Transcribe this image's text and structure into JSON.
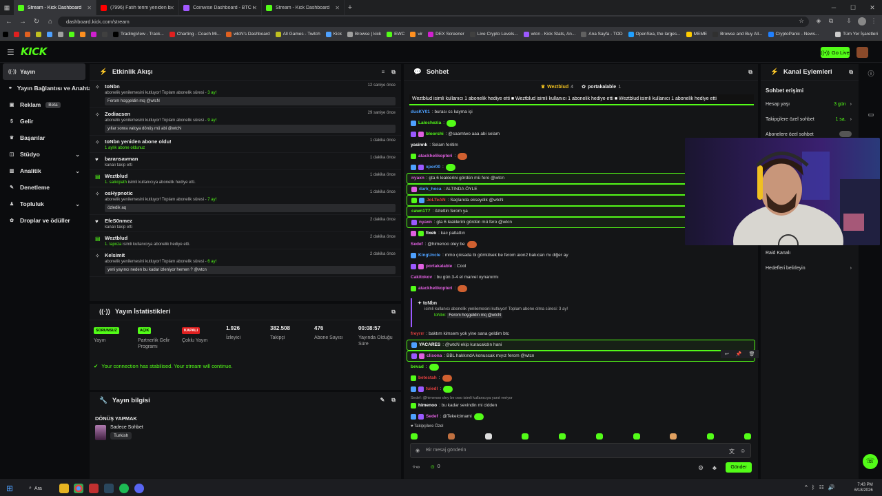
{
  "browser": {
    "tabs": [
      {
        "label": "Stream - Kick Dashboard",
        "color": "#53fc18",
        "active": true
      },
      {
        "label": "(7996) Fatih terim yeniden başk",
        "color": "#ff0000"
      },
      {
        "label": "Coinwise Dashboard - BTC Crypt",
        "color": "#a259ff"
      },
      {
        "label": "Stream - Kick Dashboard",
        "color": "#53fc18"
      }
    ],
    "url": "dashboard.kick.com/stream",
    "bookmarks": [
      "TradingView - Track...",
      "Charting - Coach Mi...",
      "wtcN's Dashboard",
      "All Games - Twitch",
      "Kick",
      "Browse | kick",
      "EWC",
      "vir",
      "DEX Screener",
      "Live Crypto Levels...",
      "wtcn - Kick Stats, An...",
      "Ana Sayfa - TOD",
      "OpenSea, the larges...",
      "MEME",
      "Browse and Buy All...",
      "CryptoPanic - News...",
      "Tüm Yer İşaretleri"
    ]
  },
  "header": {
    "logo": "KICK",
    "golive": "Go Live"
  },
  "sidebar": [
    {
      "label": "Yayın",
      "icon": "broadcast-icon",
      "active": true
    },
    {
      "label": "Yayın Bağlantısı ve Anahtarı",
      "icon": "link-icon"
    },
    {
      "label": "Reklam",
      "icon": "ad-icon",
      "badge": "Beta"
    },
    {
      "label": "Gelir",
      "icon": "dollar-icon"
    },
    {
      "label": "Başarılar",
      "icon": "trophy-icon"
    },
    {
      "label": "Stüdyo",
      "icon": "studio-icon",
      "chevron": true
    },
    {
      "label": "Analitik",
      "icon": "chart-icon",
      "chevron": true
    },
    {
      "label": "Denetleme",
      "icon": "wrench-icon"
    },
    {
      "label": "Topluluk",
      "icon": "people-icon",
      "chevron": true
    },
    {
      "label": "Droplar ve ödüller",
      "icon": "gift-icon"
    }
  ],
  "activity": {
    "title": "Etkinlik Akışı",
    "items": [
      {
        "icon": "⭐",
        "name": "toNbn",
        "time": "12 saniye önce",
        "desc": "abonelik yenilemesini kutluyor! Toplam abonelik süresi - ",
        "hl": "3 ay!",
        "msg": "Ferom hoşgeldin mq @wtcN"
      },
      {
        "icon": "⭐",
        "name": "Zodiacsen",
        "time": "29 saniye önce",
        "desc": "abonelik yenilemesini kutluyor! Toplam abonelik süresi - ",
        "hl": "9 ay!",
        "msg": "yıllar sonra valoya dönüş mü abi @wtcN"
      },
      {
        "icon": "⭐",
        "name": "toNbn yeniden abone oldu!",
        "time": "1 dakika önce",
        "desc": "",
        "hl": "1 aylık abone oldunuz",
        "msg": ""
      },
      {
        "icon": "♥",
        "name": "baransavman",
        "time": "1 dakika önce",
        "desc": "kanalı takip etti",
        "hl": "",
        "msg": ""
      },
      {
        "icon": "🎁",
        "name": "Weztblud",
        "time": "1 dakika önce",
        "desc": " isimli kullanıcıya abonelik hediye etti.",
        "hl": "1. saikcpath",
        "msg": ""
      },
      {
        "icon": "⭐",
        "name": "osHypnotic",
        "time": "1 dakika önce",
        "desc": "abonelik yenilemesini kutluyor! Toplam abonelik süresi - ",
        "hl": "7 ay!",
        "msg": "özledik aq"
      },
      {
        "icon": "♥",
        "name": "EfeS0nmez",
        "time": "2 dakika önce",
        "desc": "kanalı takip etti",
        "hl": "",
        "msg": ""
      },
      {
        "icon": "🎁",
        "name": "Weztblud",
        "time": "2 dakika önce",
        "desc": " isimli kullanıcıya abonelik hediye etti.",
        "hl": "1. lapoza",
        "msg": ""
      },
      {
        "icon": "⭐",
        "name": "Kelsimit",
        "time": "2 dakika önce",
        "desc": "abonelik yenilemesini kutluyor! Toplam abonelik süresi - ",
        "hl": "6 ay!",
        "msg": "yeni yayıncı neden bu kadar izleniyor hemen ? @wtcn"
      }
    ]
  },
  "stats": {
    "title": "Yayın İstatistikleri",
    "boxes": [
      {
        "tag": "SORUNSUZ",
        "tagbg": "#53fc18",
        "label": "Yayın"
      },
      {
        "tag": "AÇIK",
        "tagbg": "#53fc18",
        "label": "Partnerlik Gelir Programı"
      },
      {
        "tag": "KAPALI",
        "tagbg": "#e02020",
        "label": "Çoklu Yayın"
      },
      {
        "value": "1.926",
        "label": "İzleyici"
      },
      {
        "value": "382.508",
        "label": "Takipçi"
      },
      {
        "value": "476",
        "label": "Abone Sayısı"
      },
      {
        "value": "00:08:57",
        "label": "Yayında Olduğu Süre"
      }
    ],
    "connection": "Your connection has stabilised. Your stream will continue."
  },
  "info": {
    "title": "Yayın bilgisi",
    "stream_title": "DÖNÜŞ YAPMAK",
    "category": "Sadece Sohbet",
    "language": "Turkish"
  },
  "chat": {
    "title": "Sohbet",
    "pins": [
      {
        "name": "Weztblud",
        "count": "4"
      },
      {
        "name": "portakalable",
        "count": "1"
      }
    ],
    "ticker": "Weztblud isimli kullanıcı 1 abonelik hediye etti   ■   Weztblud isimli kullanıcı 1 abonelik hediye etti   ■   Weztblud isimli kullanıcı 1 abonelik hediye etti",
    "messages": [
      {
        "user": "dusKY01",
        "color": "#4ea1ff",
        "text": ": burası cs kayma işi"
      },
      {
        "user": "Lalochezia",
        "color": "#53fc18",
        "text": ":"
      },
      {
        "user": "bloorshi",
        "color": "#53fc18",
        "text": ": @saamtwo aaa abi selam"
      },
      {
        "user": "yasinnk",
        "color": "#ffffff",
        "text": ": Selam feritim"
      },
      {
        "user": "atackhelikopteri",
        "color": "#e060e0",
        "text": ":"
      },
      {
        "user": "xper00",
        "color": "#4ea1ff",
        "text": ":"
      },
      {
        "user": "nyaxn",
        "color": "#e060e0",
        "text": ": gta 6 leaklerini gördün mü fero @wtcn",
        "hl": true
      },
      {
        "user": "dark_hoca",
        "color": "#4ea1ff",
        "text": ": ALTINDA ÖYLE",
        "hl": true
      },
      {
        "user": "JoLTeAN",
        "color": "#e04040",
        "text": ": Saçlarıda ekseydik @wtcN",
        "hl": true
      },
      {
        "user": "cawn1T7",
        "color": "#53fc18",
        "text": ": özlettin ferom ya",
        "hl": true
      },
      {
        "user": "nyaxn",
        "color": "#e060e0",
        "text": ": gta 6 leaklerini gördün mü fero @wtcn",
        "hl": true
      },
      {
        "user": "fixeb",
        "color": "#ffffff",
        "text": ": kac patlattın"
      },
      {
        "user": "Sedef",
        "color": "#e060e0",
        "text": ": @himenoo oley be"
      },
      {
        "user": "KingUncle",
        "color": "#4ea1ff",
        "text": ": mmo çıksada bi gömülsek be ferom aion2 bakıcan mı diğer ay"
      },
      {
        "user": "portakalable",
        "color": "#e060e0",
        "text": ": Cool"
      },
      {
        "user": "Cakitokov",
        "color": "#e060e0",
        "text": ": bu gün 3-4 el marvel oynanırmı"
      },
      {
        "user": "atackhelikopteri",
        "color": "#e060e0",
        "text": ":"
      }
    ],
    "sub": {
      "name": "toNbn",
      "desc": "isimli kullanıcı abonelik yenilemesini kutluyor! Toplam abone olma süresi: 3 ay!",
      "msg": "Ferom hoşgeldin mq @wtcN"
    },
    "messages2": [
      {
        "user": "freyrrr",
        "color": "#e04040",
        "text": ": baktım kimsem yok yine sana geldim btc"
      },
      {
        "user": "YACARES",
        "color": "#ffffff",
        "text": ": @wtcN ekip kuracakdın hani",
        "hl": true
      },
      {
        "user": "clisona",
        "color": "#e060e0",
        "text": ": BBL hakkındA konuscak mıyız ferom @wtcn",
        "hl": true
      },
      {
        "user": "bevad",
        "color": "#53fc18",
        "text": ":"
      },
      {
        "user": "betestah",
        "color": "#e04040",
        "text": ":"
      },
      {
        "user": "tuiedl",
        "color": "#e04040",
        "text": ":"
      }
    ],
    "reply": "Sedef: @himenoo oley be owo isimli kullanıcıya yanıt veriyor",
    "messages3": [
      {
        "user": "himenoo",
        "color": "#ffffff",
        "text": ": bu kadar sevindin mi cidden"
      },
      {
        "user": "Sedef",
        "color": "#e060e0",
        "text": ": @Tekelcimami"
      }
    ],
    "followers_only": "Takipçilere Özel",
    "input_placeholder": "Bir mesaj gönderin",
    "points": "0",
    "send": "Gönder"
  },
  "channel": {
    "title": "Kanal Eylemleri",
    "section": "Sohbet erişimi",
    "rows": [
      {
        "label": "Hesap yaşı",
        "value": "3 gün"
      },
      {
        "label": "Takipçilere özel sohbet",
        "value": "1 sa."
      },
      {
        "label": "Abonelere özel sohbet",
        "value": ""
      }
    ],
    "rows2": [
      {
        "label": "Raid Kanalı"
      },
      {
        "label": "Hedefleri belirleyin"
      }
    ]
  },
  "taskbar": {
    "search": "Ara",
    "time": "7:43 PM",
    "date": "6/18/2026"
  }
}
